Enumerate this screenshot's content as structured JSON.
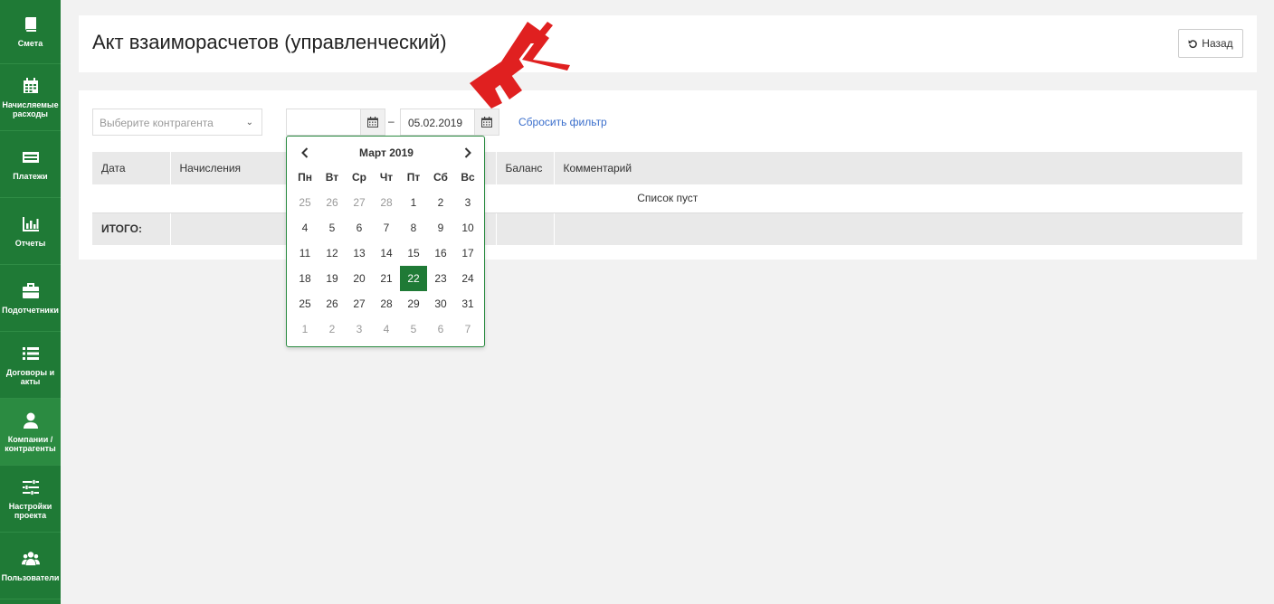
{
  "sidebar": {
    "items": [
      {
        "label": "Смета",
        "icon": "book-icon"
      },
      {
        "label": "Начисляемые расходы",
        "icon": "calendar-icon"
      },
      {
        "label": "Платежи",
        "icon": "card-icon"
      },
      {
        "label": "Отчеты",
        "icon": "bar-chart-icon"
      },
      {
        "label": "Подотчетники",
        "icon": "briefcase-icon"
      },
      {
        "label": "Договоры и акты",
        "icon": "list-icon"
      },
      {
        "label": "Компании / контрагенты",
        "icon": "user-icon"
      },
      {
        "label": "Настройки проекта",
        "icon": "sliders-icon"
      },
      {
        "label": "Пользователи",
        "icon": "users-icon"
      }
    ]
  },
  "header": {
    "title": "Акт взаиморасчетов (управленческий)",
    "back_label": "Назад"
  },
  "filter": {
    "contractor_placeholder": "Выберите контрагента",
    "date_from": "",
    "dash": "–",
    "date_to": "05.02.2019",
    "reset_label": "Сбросить фильтр"
  },
  "table": {
    "columns": [
      "Дата",
      "Начисления",
      "",
      "",
      "Баланс",
      "Комментарий"
    ],
    "empty_text": "Список пуст",
    "total_label": "ИТОГО:"
  },
  "datepicker": {
    "month_label": "Март 2019",
    "weekdays": [
      "Пн",
      "Вт",
      "Ср",
      "Чт",
      "Пт",
      "Сб",
      "Вс"
    ],
    "weeks": [
      [
        "25",
        "26",
        "27",
        "28",
        "1",
        "2",
        "3"
      ],
      [
        "4",
        "5",
        "6",
        "7",
        "8",
        "9",
        "10"
      ],
      [
        "11",
        "12",
        "13",
        "14",
        "15",
        "16",
        "17"
      ],
      [
        "18",
        "19",
        "20",
        "21",
        "22",
        "23",
        "24"
      ],
      [
        "25",
        "26",
        "27",
        "28",
        "29",
        "30",
        "31"
      ],
      [
        "1",
        "2",
        "3",
        "4",
        "5",
        "6",
        "7"
      ]
    ],
    "selected_day": "22"
  },
  "colors": {
    "sidebar": "#1f7a36",
    "accent_green": "#1f7a36",
    "link_blue": "#3b6fcc",
    "annotation_red": "#e02020"
  }
}
